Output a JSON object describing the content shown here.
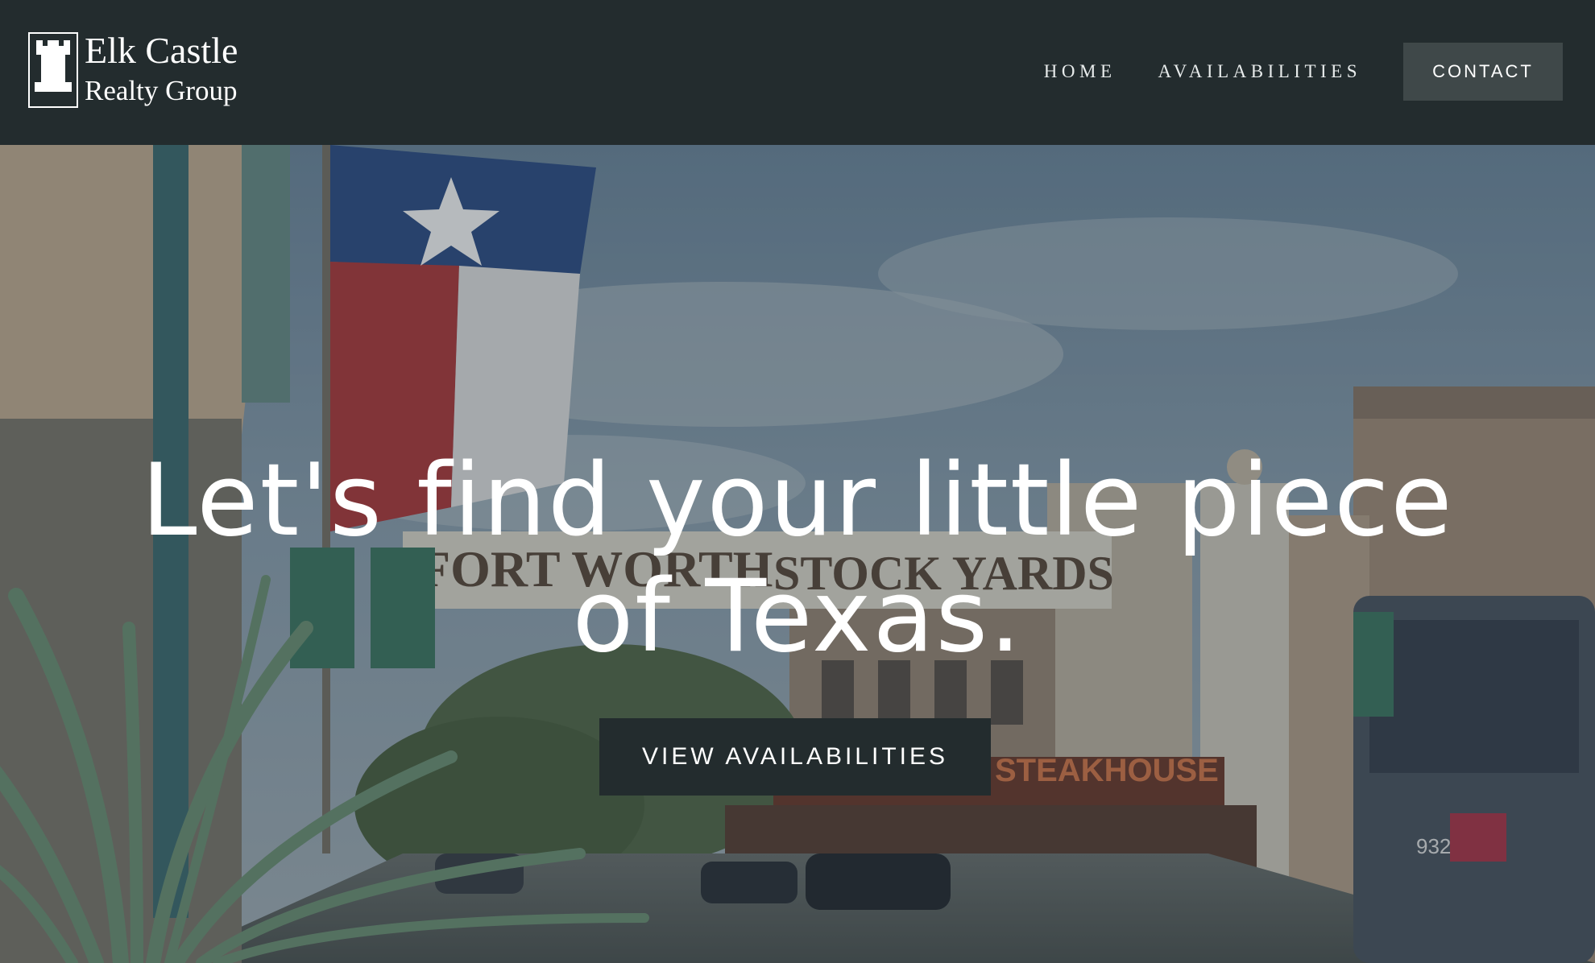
{
  "header": {
    "logo": {
      "line1": "Elk Castle",
      "line2": "Realty Group",
      "icon": "castle-rook-icon"
    },
    "nav": {
      "home": "HOME",
      "availabilities": "AVAILABILITIES",
      "contact": "CONTACT"
    }
  },
  "hero": {
    "heading": "Let's find your little piece of Texas.",
    "button_label": "VIEW AVAILABILITIES",
    "background": {
      "sign_text_left": "FORT WORTH",
      "sign_text_right": "STOCK YARDS",
      "steakhouse_sign": "STEAKHOUSE",
      "bus_number": "932"
    }
  },
  "colors": {
    "header_bg": "#232c2e",
    "cta_bg": "#3f4849",
    "hero_button_bg": "#232c2e",
    "text": "#ffffff"
  }
}
